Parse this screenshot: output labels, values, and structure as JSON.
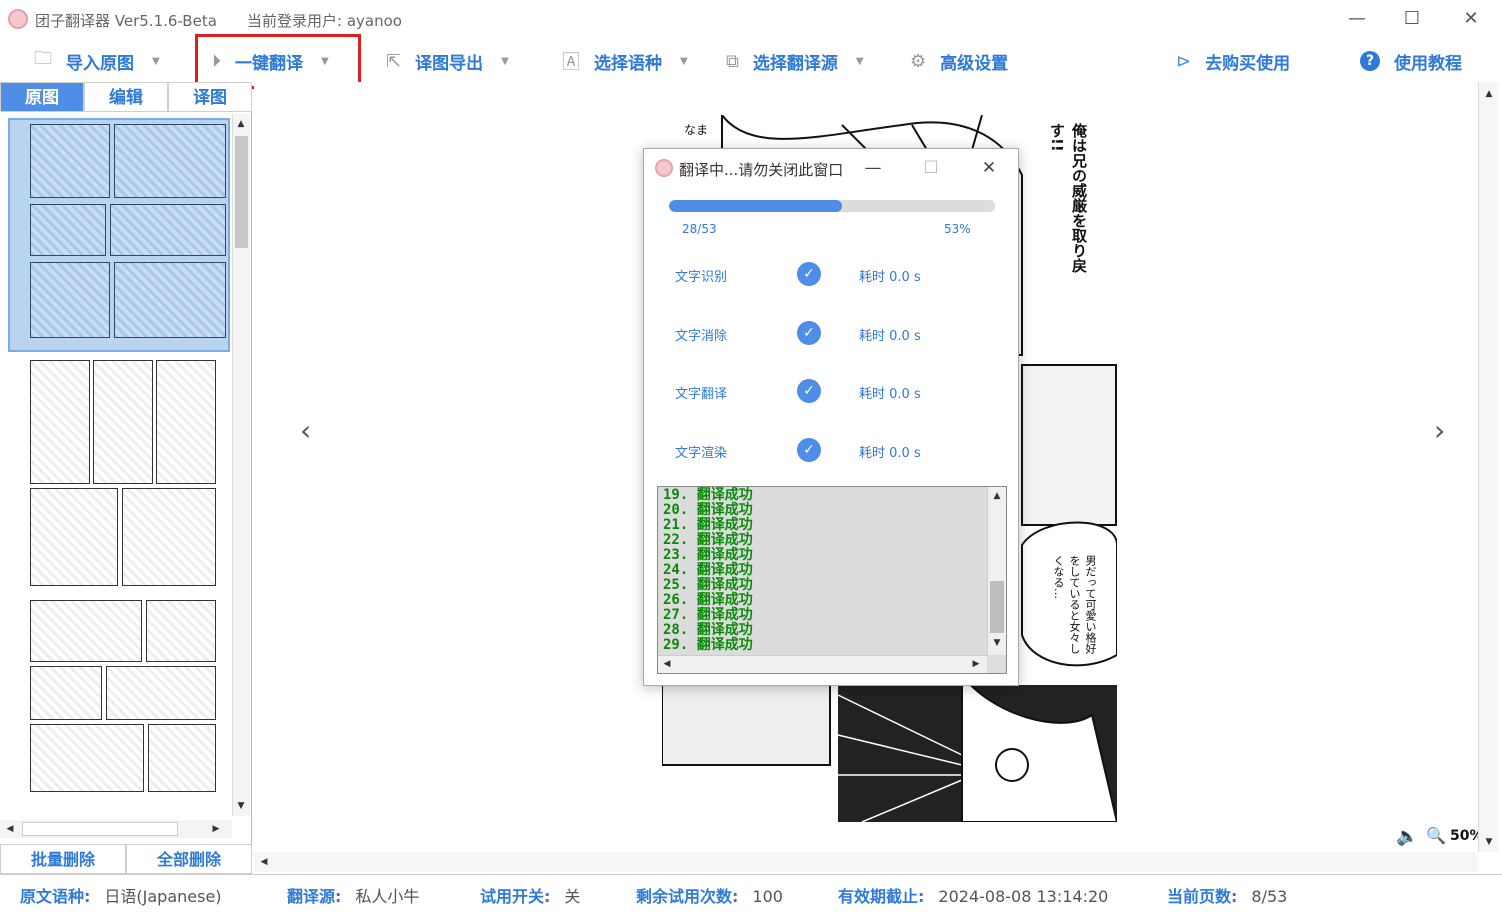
{
  "window": {
    "title": "团子翻译器 Ver5.1.6-Beta",
    "user": "当前登录用户: ayanoo",
    "minimize": "—",
    "maximize": "☐",
    "close": "✕"
  },
  "toolbar": {
    "items": [
      {
        "label": "导入原图",
        "icon": "folder-icon",
        "glyph": "🗀"
      },
      {
        "label": "一键翻译",
        "icon": "play-icon",
        "glyph": "⏵"
      },
      {
        "label": "译图导出",
        "icon": "export-icon",
        "glyph": "⇱"
      },
      {
        "label": "选择语种",
        "icon": "language-icon",
        "glyph": "🄰"
      },
      {
        "label": "选择翻译源",
        "icon": "source-icon",
        "glyph": "⧉"
      },
      {
        "label": "高级设置",
        "icon": "gear-icon",
        "glyph": "⚙"
      },
      {
        "label": "去购买使用",
        "icon": "arrow-circle-icon",
        "glyph": "⊳"
      },
      {
        "label": "使用教程",
        "icon": "help-icon",
        "glyph": "?"
      }
    ],
    "dropdown_arrow": "▼"
  },
  "tabs": [
    "原图",
    "编辑",
    "译图"
  ],
  "left_buttons": {
    "batch_delete": "批量删除",
    "delete_all": "全部删除"
  },
  "viewer": {
    "prev": "‹",
    "next": "›",
    "zoom": "50%",
    "manga_text_1": "俺は兄の威厳を取り戻す!!",
    "manga_text_2": "男だって可愛い格好をしていると女々しくなる…",
    "manga_text_3": "なま"
  },
  "dialog": {
    "title": "翻译中...请勿关闭此窗口",
    "progress_fraction": 0.53,
    "progress_count": "28/53",
    "progress_pct": "53%",
    "steps": [
      {
        "label": "文字识别",
        "time": "耗时 0.0 s"
      },
      {
        "label": "文字消除",
        "time": "耗时 0.0 s"
      },
      {
        "label": "文字翻译",
        "time": "耗时 0.0 s"
      },
      {
        "label": "文字渲染",
        "time": "耗时 0.0 s"
      }
    ],
    "log": [
      "19. 翻译成功",
      "20. 翻译成功",
      "21. 翻译成功",
      "22. 翻译成功",
      "23. 翻译成功",
      "24. 翻译成功",
      "25. 翻译成功",
      "26. 翻译成功",
      "27. 翻译成功",
      "28. 翻译成功",
      "29. 翻译成功"
    ]
  },
  "status": {
    "source_lang_key": "原文语种:",
    "source_lang_val": "日语(Japanese)",
    "engine_key": "翻译源:",
    "engine_val": "私人小牛",
    "trial_key": "试用开关:",
    "trial_val": "关",
    "remaining_key": "剩余试用次数:",
    "remaining_val": "100",
    "expiry_key": "有效期截止:",
    "expiry_val": "2024-08-08 13:14:20",
    "page_key": "当前页数:",
    "page_val": "8/53"
  },
  "colors": {
    "accent": "#2f7ad8",
    "highlight": "#e02020",
    "success": "#0a8a0a"
  }
}
